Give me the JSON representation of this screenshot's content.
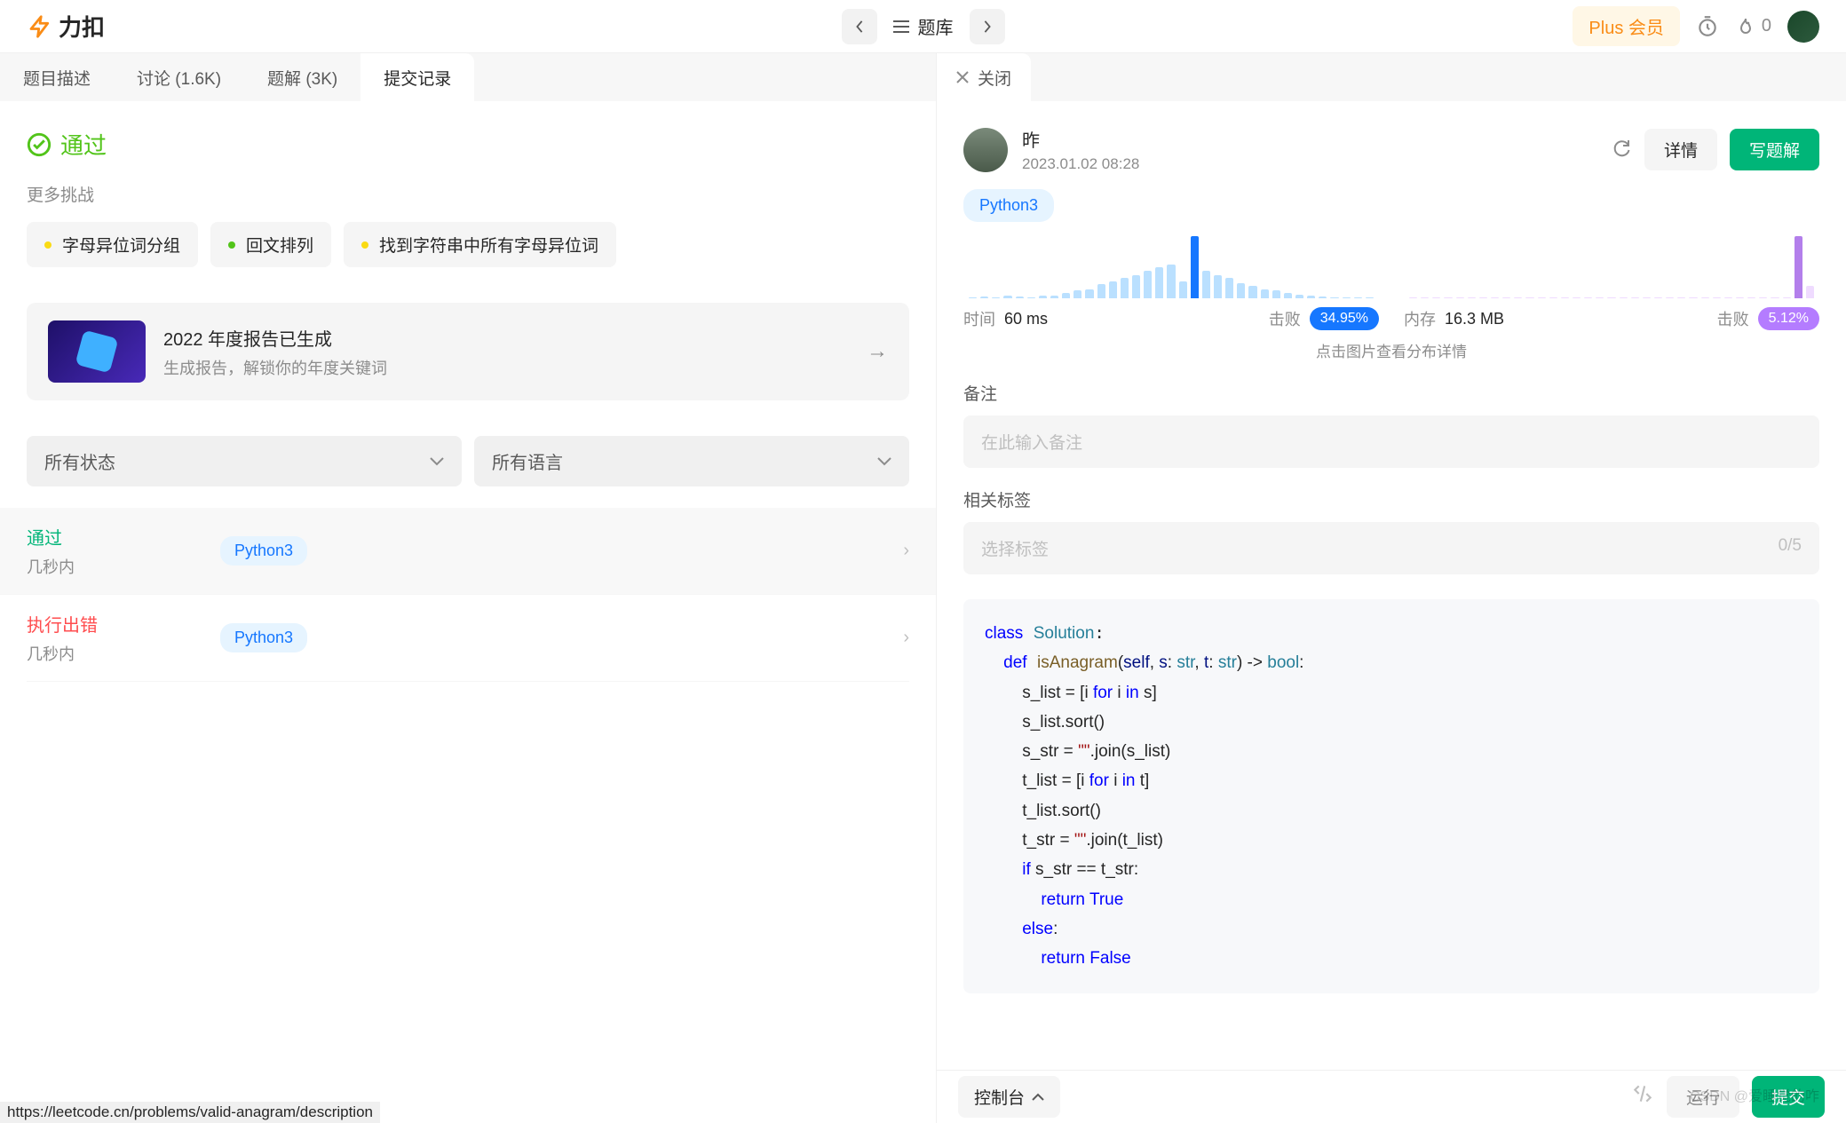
{
  "header": {
    "brand": "力扣",
    "nav_label": "题库",
    "plus_label": "Plus 会员",
    "streak_count": "0"
  },
  "tabs": [
    "题目描述",
    "讨论 (1.6K)",
    "题解 (3K)",
    "提交记录"
  ],
  "left": {
    "status_label": "通过",
    "more_label": "更多挑战",
    "challenges": [
      "字母异位词分组",
      "回文排列",
      "找到字符串中所有字母异位词"
    ],
    "report_title": "2022 年度报告已生成",
    "report_sub": "生成报告，解锁你的年度关键词",
    "filter_status": "所有状态",
    "filter_lang": "所有语言",
    "submissions": [
      {
        "status": "通过",
        "status_class": "ok",
        "time": "几秒内",
        "lang": "Python3"
      },
      {
        "status": "执行出错",
        "status_class": "err",
        "time": "几秒内",
        "lang": "Python3"
      }
    ]
  },
  "right": {
    "close_label": "关闭",
    "user_name": "昨",
    "submitted_at": "2023.01.02 08:28",
    "detail_btn": "详情",
    "write_btn": "写题解",
    "lang": "Python3",
    "time_label": "时间",
    "time_value": "60 ms",
    "beat_label": "击败",
    "time_beat": "34.95%",
    "mem_label": "内存",
    "mem_value": "16.3 MB",
    "mem_beat": "5.12%",
    "chart_hint": "点击图片查看分布详情",
    "note_label": "备注",
    "note_placeholder": "在此输入备注",
    "tag_label": "相关标签",
    "tag_placeholder": "选择标签",
    "tag_count": "0/5",
    "console_label": "控制台",
    "run_label": "运行",
    "submit_label": "提交"
  },
  "chart_data": [
    {
      "type": "bar",
      "metric": "time",
      "unit": "ms",
      "highlight_value": 60,
      "beat_percent": 34.95,
      "bars": [
        1,
        2,
        1,
        3,
        2,
        1,
        3,
        4,
        7,
        10,
        12,
        18,
        22,
        26,
        30,
        36,
        40,
        44,
        22,
        80,
        36,
        30,
        26,
        20,
        16,
        12,
        10,
        7,
        5,
        3,
        2,
        1,
        1,
        1,
        1
      ]
    },
    {
      "type": "bar",
      "metric": "memory",
      "unit": "MB",
      "highlight_value": 16.3,
      "beat_percent": 5.12,
      "bars": [
        1,
        1,
        1,
        1,
        1,
        1,
        1,
        1,
        1,
        1,
        1,
        1,
        1,
        1,
        1,
        1,
        1,
        1,
        1,
        1,
        1,
        1,
        1,
        1,
        1,
        1,
        1,
        1,
        1,
        1,
        1,
        1,
        1,
        50,
        10
      ]
    }
  ],
  "code": {
    "class_kw": "class",
    "class_name": "Solution",
    "l1": "    ",
    "def_kw": "def",
    "fn_name": "isAnagram",
    "sig_open": "(",
    "self": "self",
    "c1": ", ",
    "p1": "s",
    "colon1": ": ",
    "t1": "str",
    "c2": ", ",
    "p2": "t",
    "colon2": ": ",
    "t2": "str",
    "sig_close": ") -> ",
    "ret_t": "bool",
    "colon3": ":",
    "l2": "        s_list = [i ",
    "for_kw": "for",
    "l2b": " i ",
    "in_kw": "in",
    "l2c": " s]",
    "l3": "        s_list.sort()",
    "l4a": "        s_str = ",
    "str1": "\"\"",
    "l4b": ".join(s_list)",
    "l5": "        t_list = [i ",
    "l5b": " i ",
    "l5c": " t]",
    "l6": "        t_list.sort()",
    "l7a": "        t_str = ",
    "l7b": ".join(t_list)",
    "l8a": "        ",
    "if_kw": "if",
    "l8b": " s_str == t_str:",
    "l9a": "            ",
    "ret_kw": "return",
    "sp": " ",
    "true_kw": "True",
    "l10a": "        ",
    "else_kw": "else",
    "l10b": ":",
    "l11a": "            ",
    "false_kw": "False"
  },
  "statusbar": "https://leetcode.cn/problems/valid-anagram/description",
  "watermark": "CSDN @爱睡觉的咋"
}
